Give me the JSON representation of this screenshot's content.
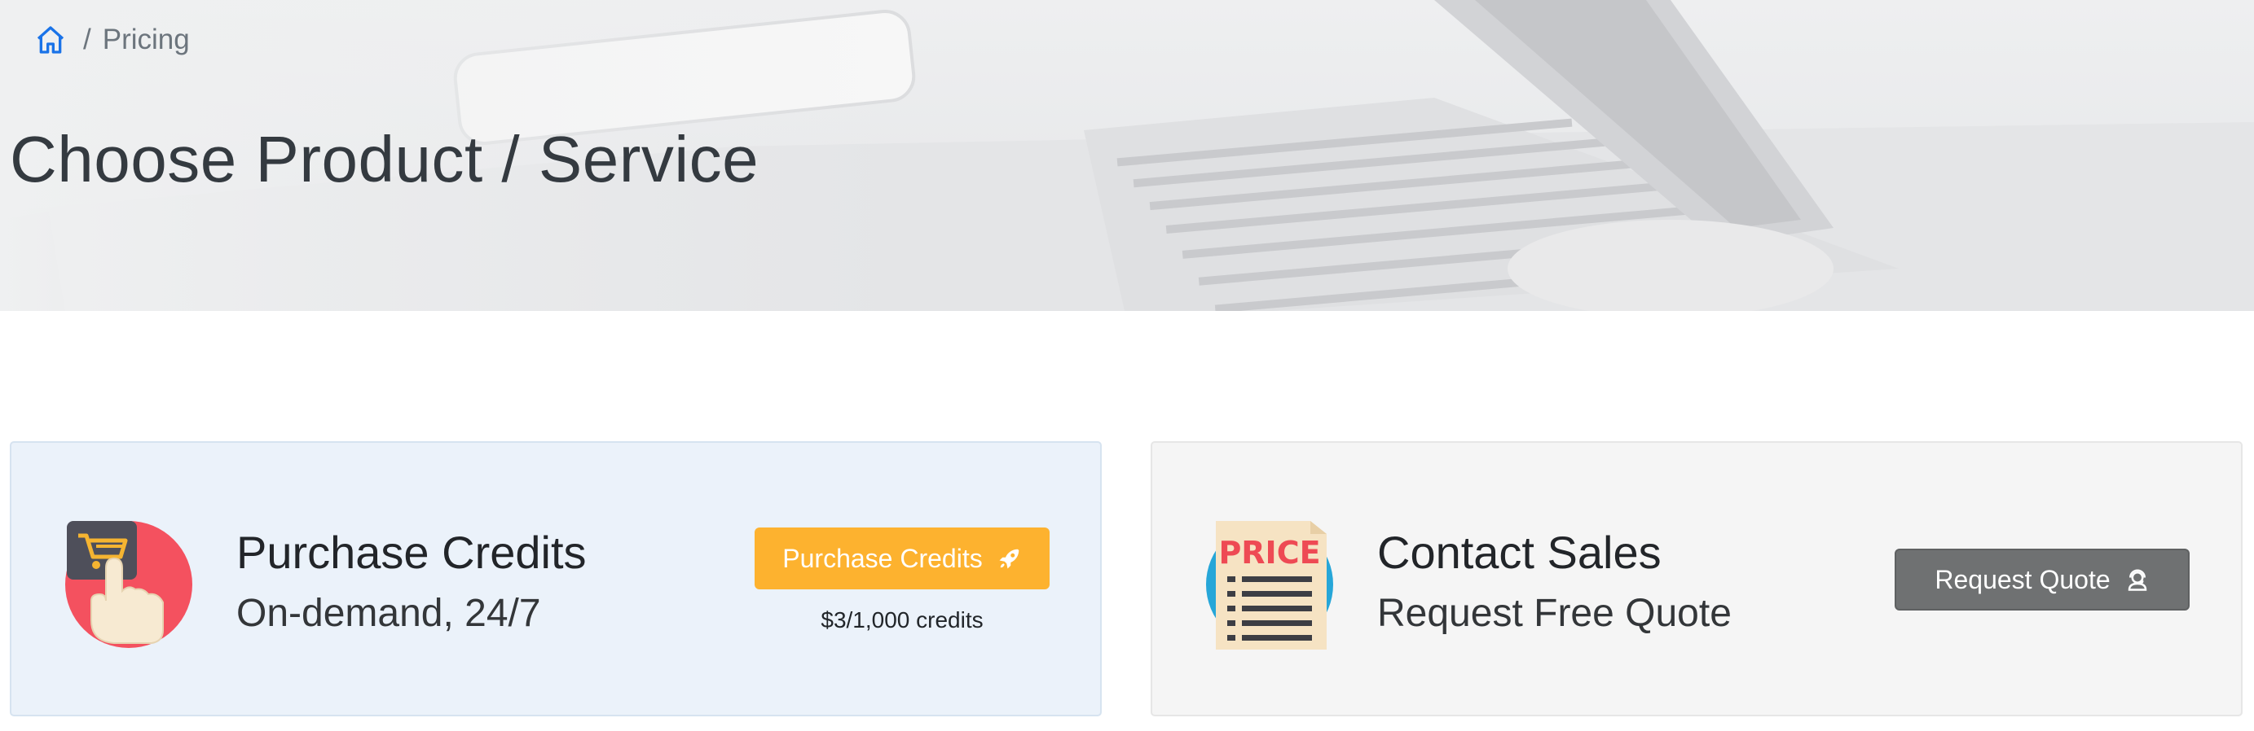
{
  "breadcrumb": {
    "home_icon": "home-icon",
    "separator": "/",
    "current": "Pricing"
  },
  "hero": {
    "title": "Choose Product / Service"
  },
  "cards": {
    "credits": {
      "icon": "shopping-cart-touch-icon",
      "title": "Purchase Credits",
      "subtitle": "On-demand, 24/7",
      "button_label": "Purchase Credits",
      "button_icon": "rocket-icon",
      "button_color": "#fdb22f",
      "price_note": "$3/1,000 credits"
    },
    "sales": {
      "icon": "price-list-icon",
      "icon_text": "PRICE",
      "title": "Contact Sales",
      "subtitle": "Request Free Quote",
      "button_label": "Request Quote",
      "button_icon": "support-agent-icon",
      "button_color": "#6f7172"
    }
  }
}
